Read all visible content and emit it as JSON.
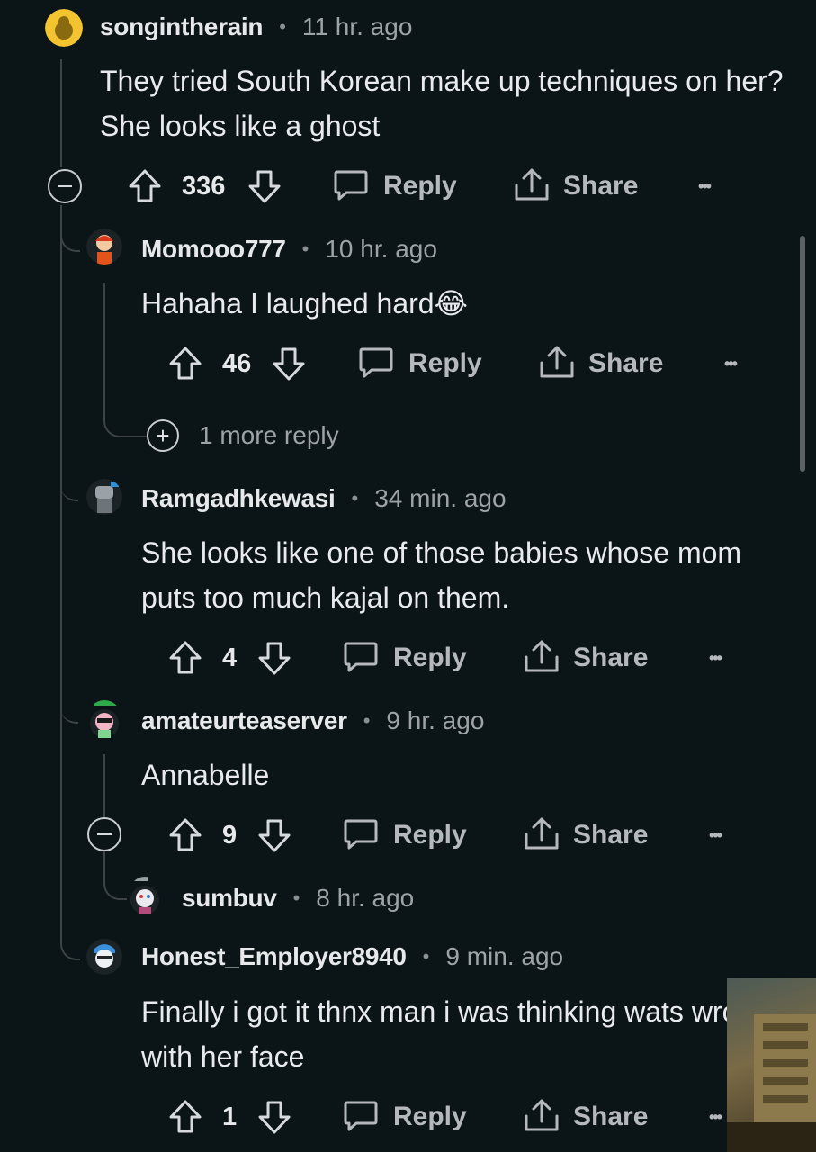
{
  "comments": [
    {
      "user": "songintherain",
      "time": "11 hr. ago",
      "body": "They tried South Korean make up techniques on her? She looks like a ghost",
      "votes": "336"
    },
    {
      "user": "Momooo777",
      "time": "10 hr. ago",
      "body": "Hahaha I laughed hard😂",
      "votes": "46"
    },
    {
      "user": "Ramgadhkewasi",
      "time": "34 min. ago",
      "body": "She looks like one of those babies whose mom puts too much kajal on them.",
      "votes": "4"
    },
    {
      "user": "amateurteaserver",
      "time": "9 hr. ago",
      "body": "Annabelle",
      "votes": "9"
    },
    {
      "user": "sumbuv",
      "time": "8 hr. ago"
    },
    {
      "user": "Honest_Employer8940",
      "time": "9 min. ago",
      "body": "Finally i got it thnx man i was thinking wats wrong with her face",
      "votes": "1"
    }
  ],
  "more_replies_label": "1 more reply",
  "actions": {
    "reply": "Reply",
    "share": "Share",
    "more": "•••"
  },
  "meta_separator": "•",
  "colors": {
    "background": "#0b1416",
    "thread_line": "#3e4346",
    "action_text": "#b5b9bc"
  }
}
